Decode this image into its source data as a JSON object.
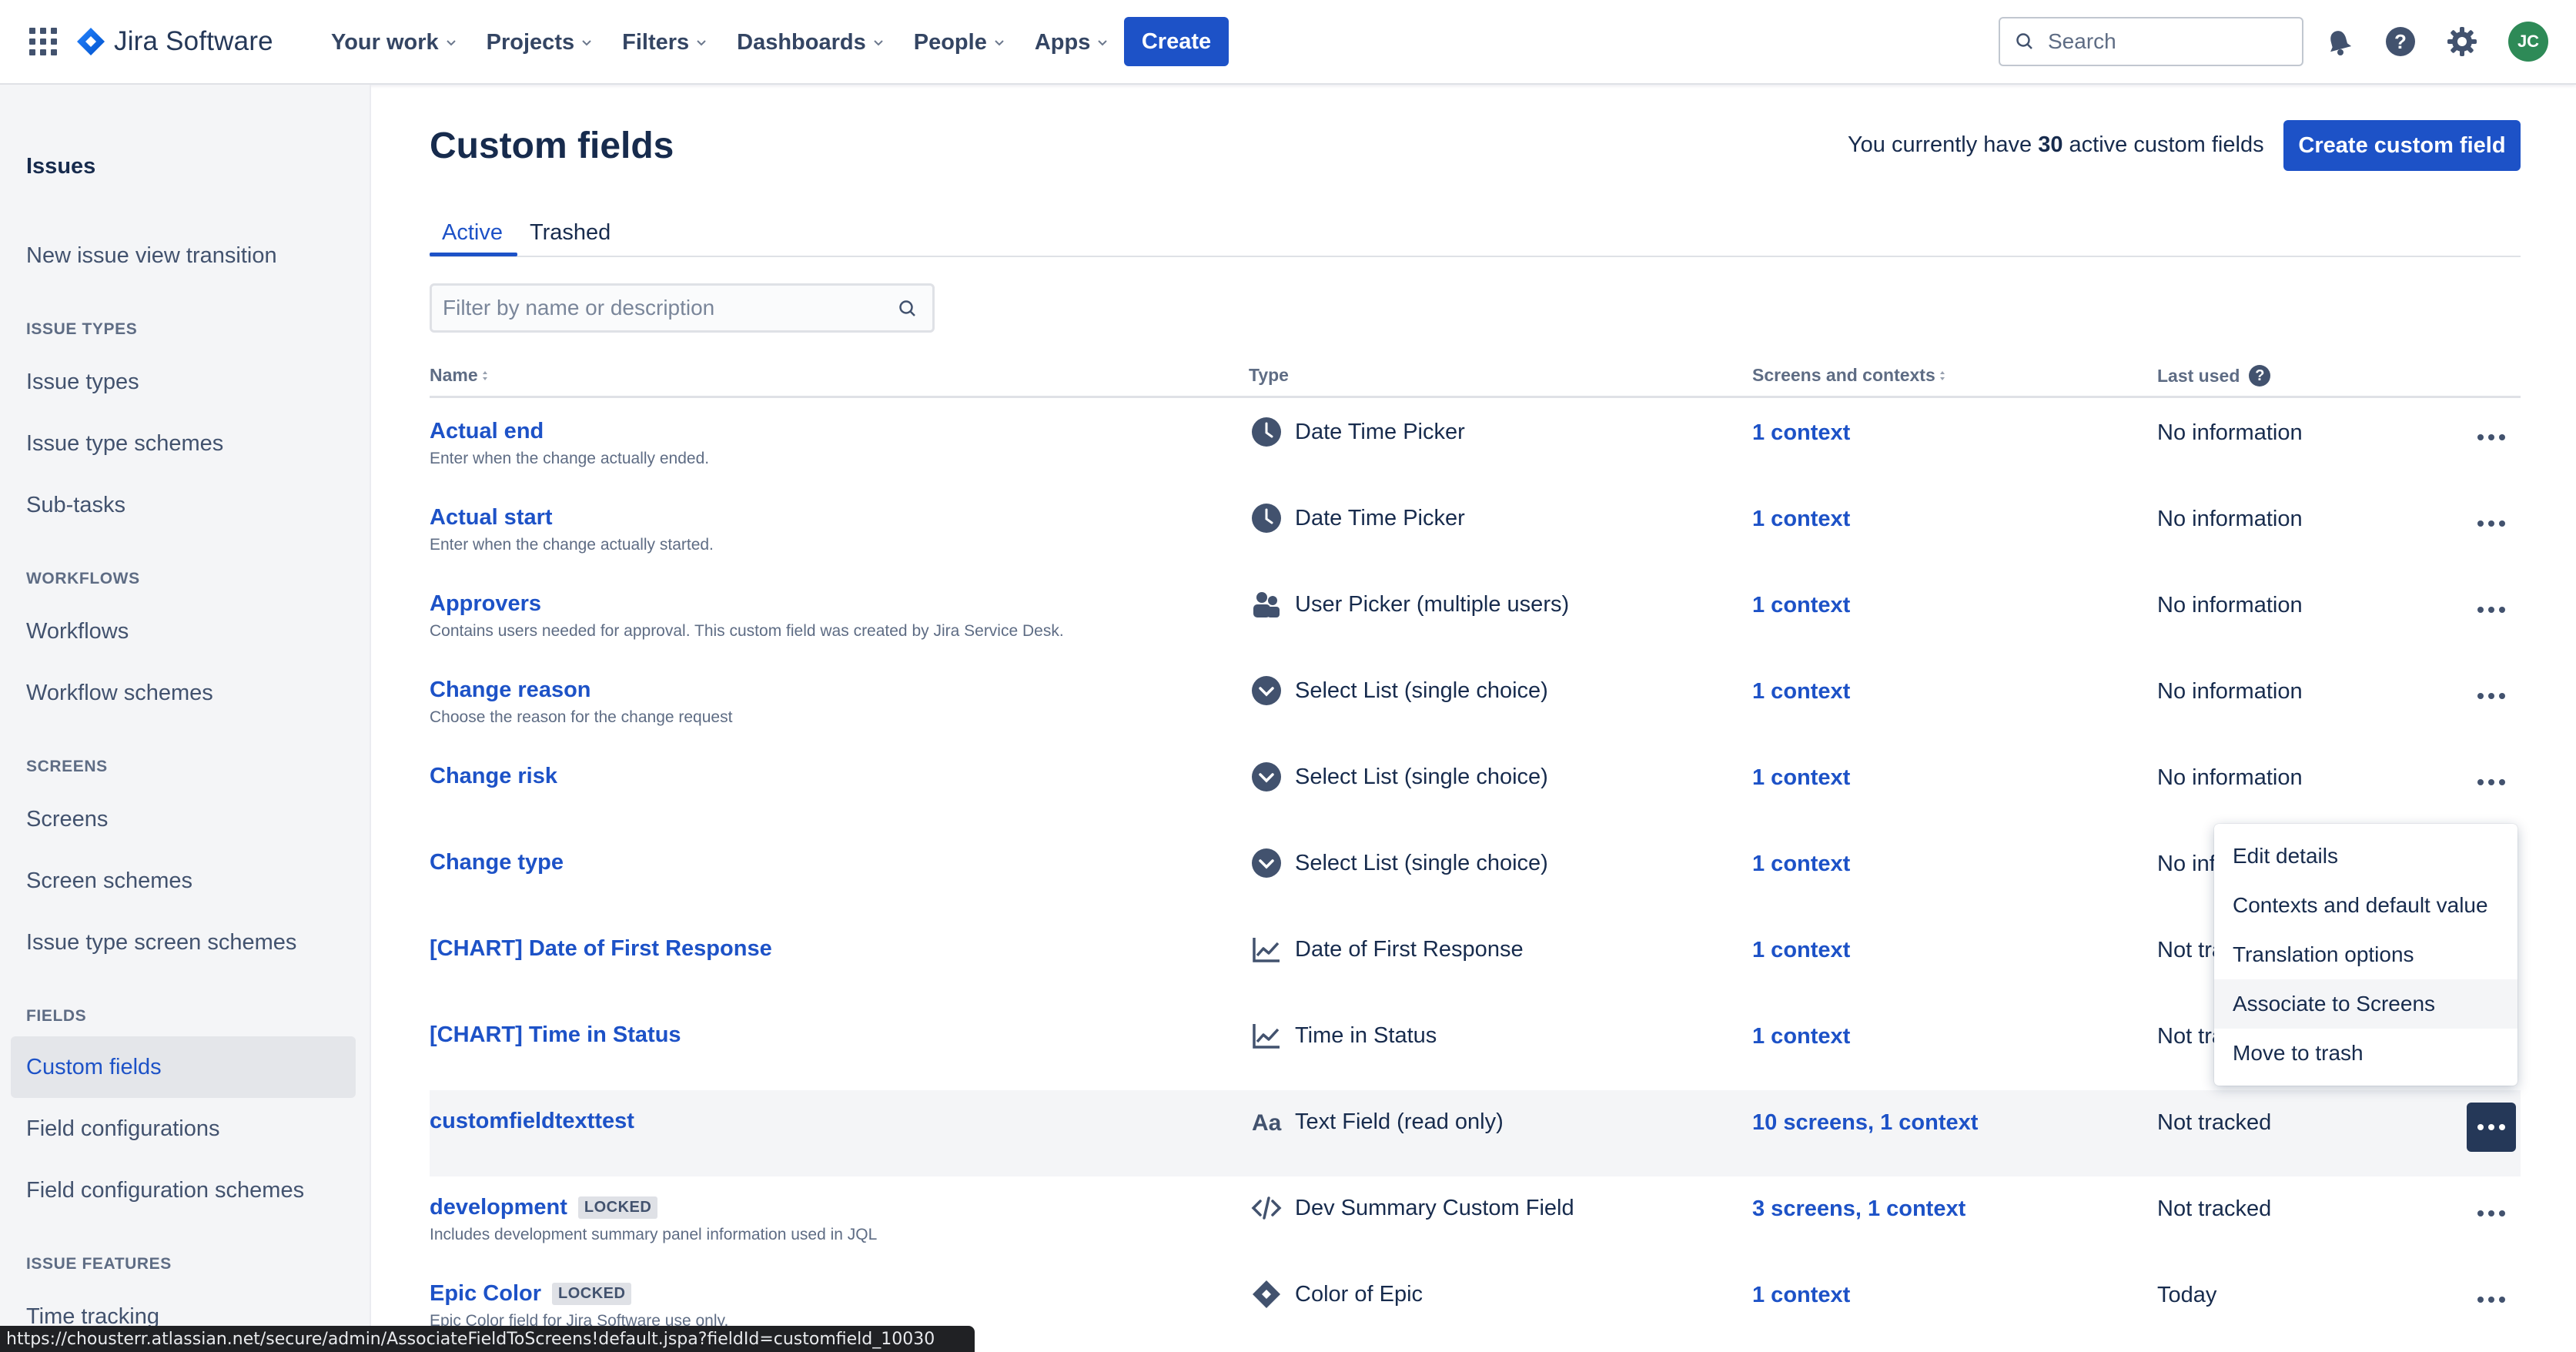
{
  "topnav": {
    "logo_text": "Jira Software",
    "items": [
      {
        "label": "Your work"
      },
      {
        "label": "Projects"
      },
      {
        "label": "Filters"
      },
      {
        "label": "Dashboards"
      },
      {
        "label": "People"
      },
      {
        "label": "Apps"
      }
    ],
    "create_label": "Create",
    "search_placeholder": "Search",
    "avatar_initials": "JC",
    "icons": [
      "app-switcher-icon",
      "notifications-icon",
      "help-icon",
      "settings-icon"
    ]
  },
  "sidebar": {
    "title": "Issues",
    "top_items": [
      "New issue view transition"
    ],
    "sections": [
      {
        "heading": "ISSUE TYPES",
        "items": [
          "Issue types",
          "Issue type schemes",
          "Sub-tasks"
        ]
      },
      {
        "heading": "WORKFLOWS",
        "items": [
          "Workflows",
          "Workflow schemes"
        ]
      },
      {
        "heading": "SCREENS",
        "items": [
          "Screens",
          "Screen schemes",
          "Issue type screen schemes"
        ]
      },
      {
        "heading": "FIELDS",
        "items": [
          "Custom fields",
          "Field configurations",
          "Field configuration schemes"
        ]
      },
      {
        "heading": "ISSUE FEATURES",
        "items": [
          "Time tracking"
        ]
      }
    ],
    "active_item": "Custom fields"
  },
  "main": {
    "title": "Custom fields",
    "count_prefix": "You currently have",
    "count_value": "30",
    "count_suffix": "active custom fields",
    "create_button": "Create custom field",
    "tabs": [
      {
        "label": "Active"
      },
      {
        "label": "Trashed"
      }
    ],
    "filter_placeholder": "Filter by name or description",
    "columns": {
      "name": "Name",
      "type": "Type",
      "screens": "Screens and contexts",
      "last_used": "Last used"
    },
    "rows": [
      {
        "name": "Actual end",
        "desc": "Enter when the change actually ended.",
        "type": "Date Time Picker",
        "type_icon": "clock-icon",
        "ctx": "1 context",
        "last_used": "No information"
      },
      {
        "name": "Actual start",
        "desc": "Enter when the change actually started.",
        "type": "Date Time Picker",
        "type_icon": "clock-icon",
        "ctx": "1 context",
        "last_used": "No information"
      },
      {
        "name": "Approvers",
        "desc": "Contains users needed for approval. This custom field was created by Jira Service Desk.",
        "type": "User Picker (multiple users)",
        "type_icon": "people-icon",
        "ctx": "1 context",
        "last_used": "No information"
      },
      {
        "name": "Change reason",
        "desc": "Choose the reason for the change request",
        "type": "Select List (single choice)",
        "type_icon": "select-icon",
        "ctx": "1 context",
        "last_used": "No information"
      },
      {
        "name": "Change risk",
        "desc": "",
        "type": "Select List (single choice)",
        "type_icon": "select-icon",
        "ctx": "1 context",
        "last_used": "No information"
      },
      {
        "name": "Change type",
        "desc": "",
        "type": "Select List (single choice)",
        "type_icon": "select-icon",
        "ctx": "1 context",
        "last_used": "No inf"
      },
      {
        "name": "[CHART] Date of First Response",
        "desc": "",
        "type": "Date of First Response",
        "type_icon": "chart-icon",
        "ctx": "1 context",
        "last_used": "Not tra"
      },
      {
        "name": "[CHART] Time in Status",
        "desc": "",
        "type": "Time in Status",
        "type_icon": "chart-icon",
        "ctx": "1 context",
        "last_used": "Not tra"
      },
      {
        "name": "customfieldtexttest",
        "desc": "",
        "type": "Text Field (read only)",
        "type_icon": "text-icon",
        "ctx": "10 screens, 1 context",
        "last_used": "Not tracked"
      },
      {
        "name": "development",
        "locked": "LOCKED",
        "desc": "Includes development summary panel information used in JQL",
        "type": "Dev Summary Custom Field",
        "type_icon": "code-icon",
        "ctx": "3 screens, 1 context",
        "last_used": "Not tracked"
      },
      {
        "name": "Epic Color",
        "locked": "LOCKED",
        "desc": "Epic Color field for Jira Software use only.",
        "type": "Color of Epic",
        "type_icon": "diamond-icon",
        "ctx": "1 context",
        "last_used": "Today"
      }
    ]
  },
  "menu": {
    "items": [
      "Edit details",
      "Contexts and default value",
      "Translation options",
      "Associate to Screens",
      "Move to trash"
    ],
    "hovered": "Associate to Screens"
  },
  "statusbar": {
    "url": "https://chousterr.atlassian.net/secure/admin/AssociateFieldToScreens!default.jspa?fieldId=customfield_10030"
  },
  "colors": {
    "link": "#1d52c7",
    "primary_button": "#1d52c7",
    "sidebar_bg": "#f4f5f7",
    "text": "#172b4d"
  }
}
